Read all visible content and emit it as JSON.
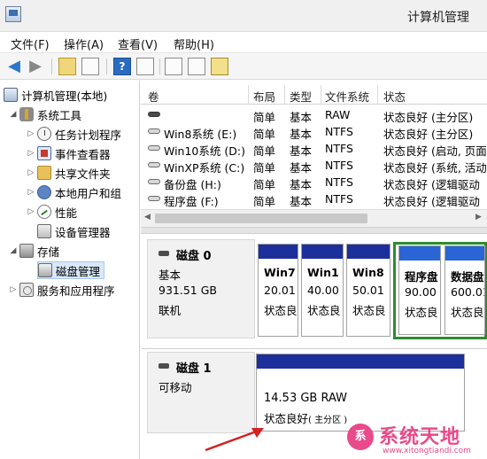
{
  "window": {
    "title": "计算机管理"
  },
  "menu": [
    {
      "label": "文件(F)"
    },
    {
      "label": "操作(A)"
    },
    {
      "label": "查看(V)"
    },
    {
      "label": "帮助(H)"
    }
  ],
  "toolbar": {
    "help_glyph": "?"
  },
  "tree": {
    "root": "计算机管理(本地)",
    "system_tools": "系统工具",
    "task_scheduler": "任务计划程序",
    "event_viewer": "事件查看器",
    "shared_folders": "共享文件夹",
    "local_users": "本地用户和组",
    "performance": "性能",
    "device_manager": "设备管理器",
    "storage": "存储",
    "disk_management": "磁盘管理",
    "services_apps": "服务和应用程序"
  },
  "volume_table": {
    "headers": [
      "卷",
      "布局",
      "类型",
      "文件系统",
      "状态"
    ],
    "rows": [
      {
        "name": "",
        "layout": "简单",
        "type": "基本",
        "fs": "RAW",
        "status": "状态良好 (主分区)",
        "raw": true
      },
      {
        "name": "Win8系统 (E:)",
        "layout": "简单",
        "type": "基本",
        "fs": "NTFS",
        "status": "状态良好 (主分区)",
        "raw": false
      },
      {
        "name": "Win10系统 (D:)",
        "layout": "简单",
        "type": "基本",
        "fs": "NTFS",
        "status": "状态良好 (启动, 页面",
        "raw": false
      },
      {
        "name": "WinXP系统 (C:)",
        "layout": "简单",
        "type": "基本",
        "fs": "NTFS",
        "status": "状态良好 (系统, 活动",
        "raw": false
      },
      {
        "name": "备份盘 (H:)",
        "layout": "简单",
        "type": "基本",
        "fs": "NTFS",
        "status": "状态良好 (逻辑驱动",
        "raw": false
      },
      {
        "name": "程序盘 (F:)",
        "layout": "简单",
        "type": "基本",
        "fs": "NTFS",
        "status": "状态良好 (逻辑驱动",
        "raw": false
      }
    ]
  },
  "disk0": {
    "name": "磁盘 0",
    "kind": "基本",
    "size": "931.51 GB",
    "state": "联机",
    "partitions": [
      {
        "name": "Win7",
        "size": "20.01",
        "status": "状态良"
      },
      {
        "name": "Win1",
        "size": "40.00",
        "status": "状态良"
      },
      {
        "name": "Win8",
        "size": "50.01",
        "status": "状态良"
      },
      {
        "name": "程序盘",
        "size": "90.00",
        "status": "状态良"
      },
      {
        "name": "数据盘",
        "size": "600.01",
        "status": "状态良"
      }
    ]
  },
  "disk1": {
    "name": "磁盘 1",
    "kind": "可移动",
    "raw_size": "14.53 GB RAW",
    "raw_status": "状态良好",
    "raw_status_paren": "( 主分区 )"
  },
  "watermark": {
    "logo": "系",
    "text": "系统天地",
    "url": "www.xitongtiandi.com"
  },
  "colors": {
    "primary_partition": "#1c2f9a",
    "logical_partition": "#2a65d6",
    "extended_border": "#2f8b2f",
    "arrow": "#d32222",
    "watermark": "#e94a8a"
  }
}
